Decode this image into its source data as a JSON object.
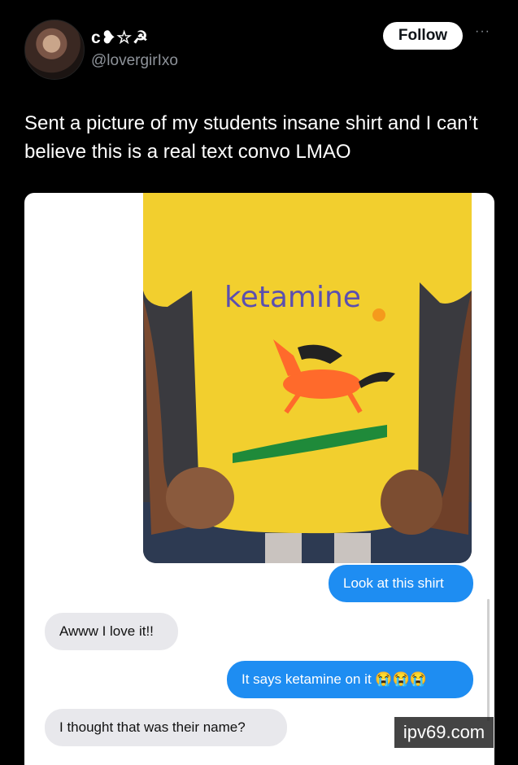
{
  "tweet": {
    "display_name": "c❥☆☭",
    "handle": "@lovergirIxo",
    "follow_label": "Follow",
    "more_label": "···",
    "text": "Sent a picture of my students insane shirt and I can’t believe this is a real text convo LMAO"
  },
  "image": {
    "shirt_text": "ketamine",
    "messages": [
      {
        "from": "me",
        "text": "Look at this shirt"
      },
      {
        "from": "them",
        "text": "Awww I love it!!"
      },
      {
        "from": "me",
        "text": "It says ketamine on it 😭😭😭"
      },
      {
        "from": "them",
        "text": "I thought that was their name?"
      }
    ]
  },
  "watermark": "ipv69.com",
  "colors": {
    "background": "#000000",
    "sent_bubble": "#1e8df2",
    "received_bubble": "#e8e8ec",
    "shirt": "#f2cf2e"
  }
}
